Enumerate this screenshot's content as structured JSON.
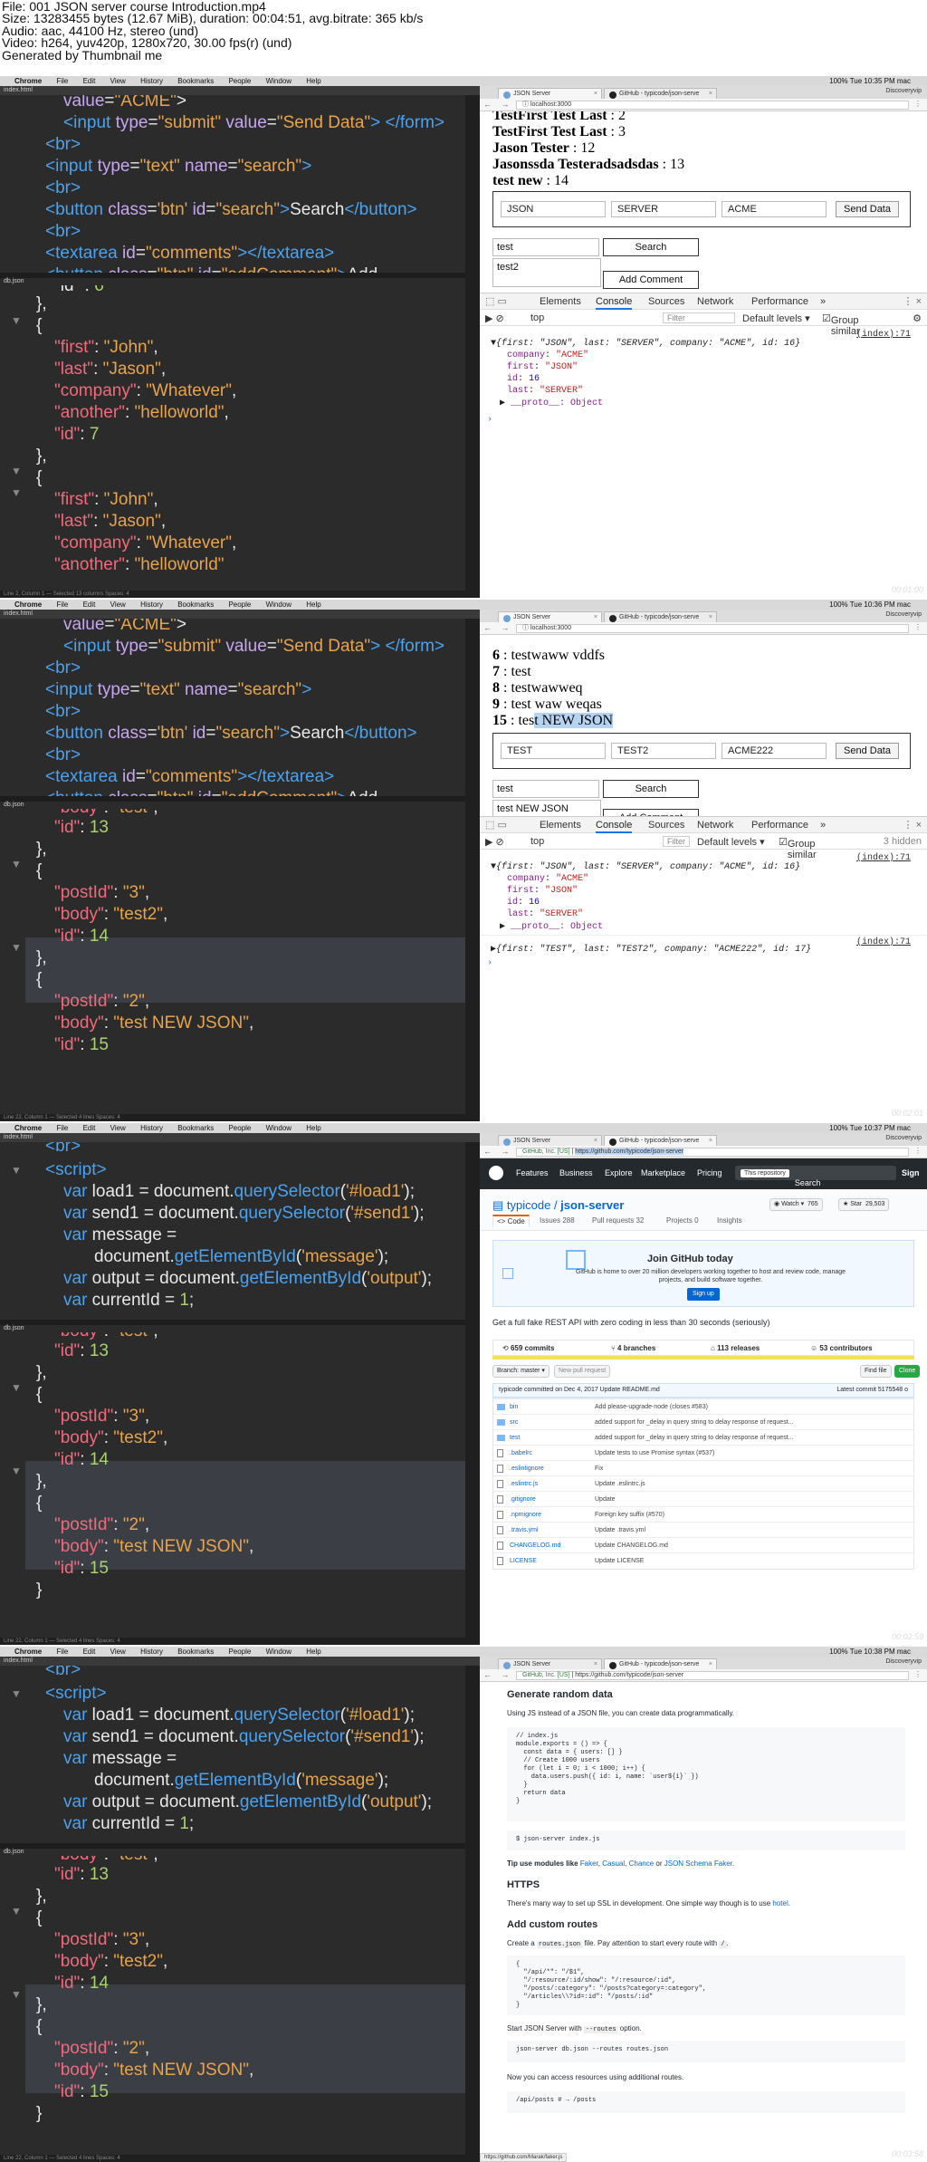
{
  "header": {
    "lines": [
      "File: 001 JSON server course Introduction.mp4",
      "Size: 13283455 bytes (12.67 MiB), duration: 00:04:51, avg.bitrate: 365 kb/s",
      "Audio: aac, 44100 Hz, stereo (und)",
      "Video: h264, yuv420p, 1280x720, 30.00 fps(r) (und)",
      "Generated by Thumbnail me"
    ]
  },
  "menubar": {
    "apple": "",
    "items": [
      "Chrome",
      "File",
      "Edit",
      "View",
      "History",
      "Bookmarks",
      "People",
      "Window",
      "Help"
    ]
  },
  "frames": [
    {
      "status_time": "100% Tue 10:35 PM mac",
      "watermark": "00:01:00",
      "file1": "index.html",
      "file2": "db.json",
      "tabs": [
        {
          "label": "JSON Server"
        },
        {
          "label": "GitHub - typicode/json-serve"
        }
      ],
      "profile": "Discoveryvip",
      "url": "localhost:3000",
      "records": [
        {
          "name": "TestFirst Test Last",
          "id": "2"
        },
        {
          "name": "TestFirst Test Last",
          "id": "3"
        },
        {
          "name": "Jason Tester",
          "id": "12"
        },
        {
          "name": "Jasonssda Testeradsadsdas",
          "id": "13"
        },
        {
          "name": "test new",
          "id": "14"
        }
      ],
      "form": {
        "v1": "JSON",
        "v2": "SERVER",
        "v3": "ACME",
        "btn": "Send Data"
      },
      "search_value": "test",
      "search_btn": "Search",
      "textarea_value": "test2",
      "comment_btn": "Add Comment",
      "statusbar": "Line 2, Column 1 — Selected 13 columns   Spaces: 4"
    },
    {
      "status_time": "100% Tue 10:36 PM mac",
      "watermark": "00:02:01",
      "file1": "index.html",
      "file2": "db.json",
      "tabs": [
        {
          "label": "JSON Server"
        },
        {
          "label": "GitHub - typicode/json-serve"
        }
      ],
      "profile": "Discoveryvip",
      "url": "localhost:3000",
      "records": [
        {
          "id": "6",
          "body": "testwaww vddfs"
        },
        {
          "id": "7",
          "body": "test"
        },
        {
          "id": "8",
          "body": "testwawweq"
        },
        {
          "id": "9",
          "body": "test waw weqas"
        },
        {
          "id": "15",
          "body_pre": "tes",
          "body_sel": "t NEW JSON"
        }
      ],
      "form": {
        "v1": "TEST",
        "v2": "TEST2",
        "v3": "ACME222",
        "btn": "Send Data"
      },
      "search_value": "test",
      "search_btn": "Search",
      "textarea_value": "test NEW JSON",
      "comment_btn": "Add Comment",
      "statusbar": "Line 22, Column 1 — Selected 4 lines   Spaces: 4"
    },
    {
      "status_time": "100% Tue 10:37 PM mac",
      "watermark": "00:02:59",
      "file1": "index.html",
      "file2": "db.json",
      "tabs": [
        {
          "label": "JSON Server"
        },
        {
          "label": "GitHub - typicode/json-serve"
        }
      ],
      "profile": "Discoveryvip",
      "url_prefix": "GitHub, Inc. [US]",
      "url": "https://github.com/typicode/json-server",
      "github": {
        "nav": [
          "Features",
          "Business",
          "Explore",
          "Marketplace",
          "Pricing"
        ],
        "search_scope": "This repository",
        "search_placeholder": "Search",
        "signin": "Sign",
        "owner": "typicode",
        "repo": "json-server",
        "watch": "Watch",
        "watch_count": "765",
        "star": "★ Star",
        "star_count": "29,503",
        "reponav": [
          "<> Code",
          "Issues 288",
          "Pull requests 32",
          "Projects 0",
          "Insights"
        ],
        "banner_title": "Join GitHub today",
        "banner_text": "GitHub is home to over 20 million developers working together to host and review code, manage projects, and build software together.",
        "signup": "Sign up",
        "desc": "Get a full fake REST API with zero coding in less than 30 seconds (seriously)",
        "stats": [
          "659 commits",
          "4 branches",
          "113 releases",
          "53 contributors"
        ],
        "branch": "Branch: master ▾",
        "new_pr": "New pull request",
        "find_file": "Find file",
        "clone": "Clone",
        "commit": "typicode committed on Dec 4, 2017 Update README.md",
        "latest_commit": "Latest commit 5175548 o",
        "files": [
          {
            "name": "bin",
            "msg": "Add please-upgrade-node (closes #583)",
            "type": "dir"
          },
          {
            "name": "src",
            "msg": "added support for _delay in query string to delay response of request...",
            "type": "dir"
          },
          {
            "name": "test",
            "msg": "added support for _delay in query string to delay response of request...",
            "type": "dir"
          },
          {
            "name": ".babelrc",
            "msg": "Update tests to use Promise syntax (#537)",
            "type": "file"
          },
          {
            "name": ".eslintignore",
            "msg": "Fix",
            "type": "file"
          },
          {
            "name": ".eslintrc.js",
            "msg": "Update .eslintrc.js",
            "type": "file"
          },
          {
            "name": ".gitignore",
            "msg": "Update",
            "type": "file"
          },
          {
            "name": ".npmignore",
            "msg": "Foreign key suffix (#570)",
            "type": "file"
          },
          {
            "name": ".travis.yml",
            "msg": "Update .travis.yml",
            "type": "file"
          },
          {
            "name": "CHANGELOG.md",
            "msg": "Update CHANGELOG.md",
            "type": "file"
          },
          {
            "name": "LICENSE",
            "msg": "Update LICENSE",
            "type": "file"
          }
        ]
      },
      "statusbar": "Line 22, Column 1 — Selected 4 lines   Spaces: 4"
    },
    {
      "status_time": "100% Tue 10:38 PM mac",
      "watermark": "00:03:58",
      "file1": "index.html",
      "file2": "db.json",
      "tabs": [
        {
          "label": "JSON Server"
        },
        {
          "label": "GitHub - typicode/json-serve"
        }
      ],
      "profile": "Discoveryvip",
      "url_prefix": "GitHub, Inc. [US]",
      "url": "https://github.com/typicode/json-server",
      "readme": {
        "h1": "Generate random data",
        "p1": "Using JS instead of a JSON file, you can create data programmatically.",
        "code1": "// index.js\nmodule.exports = () => {\n  const data = { users: [] }\n  // Create 1000 users\n  for (let i = 0; i < 1000; i++) {\n    data.users.push({ id: i, name: `user${i}` })\n  }\n  return data\n}",
        "cmd1": "$ json-server index.js",
        "tip_pre": "Tip use modules like ",
        "tip_links": [
          "Faker",
          "Casual",
          "Chance"
        ],
        "tip_or": " or ",
        "tip_last": "JSON Schema Faker",
        "tip_end": ".",
        "h2": "HTTPS",
        "p2_pre": "There's many way to set up SSL in development. One simple way though is to use ",
        "p2_link": "hotel",
        "p2_end": ".",
        "h3": "Add custom routes",
        "p3_pre": "Create a ",
        "p3_code": "routes.json",
        "p3_mid": " file. Pay attention to start every route with ",
        "p3_code2": "/",
        "p3_end": ".",
        "code2": "{\n  \"/api/*\": \"/$1\",\n  \"/:resource/:id/show\": \"/:resource/:id\",\n  \"/posts/:category\": \"/posts?category=:category\",\n  \"/articles\\\\?id=:id\": \"/posts/:id\"\n}",
        "p4_pre": "Start JSON Server with ",
        "p4_code": "--routes",
        "p4_end": " option.",
        "cmd2": "json-server db.json --routes routes.json",
        "p5": "Now you can access resources using additional routes.",
        "cmd3": "/api/posts # → /posts",
        "status_url": "https://github.com/Marak/faker.js"
      },
      "statusbar": "Line 22, Column 1 — Selected 4 lines   Spaces: 4"
    }
  ],
  "devtools": {
    "tabs": [
      "Elements",
      "Console",
      "Sources",
      "Network",
      "Performance",
      "»"
    ],
    "top": "top",
    "filter": "Filter",
    "levels": "Default levels ▾",
    "group": "Group similar",
    "hidden": "3 hidden",
    "src": "(index):71",
    "obj_summary_1": "{first: \"JSON\", last: \"SERVER\", company: \"ACME\", id: 16}",
    "obj_summary_2": "{first: \"TEST\", last: \"TEST2\", company: \"ACME222\", id: 17}",
    "props": [
      {
        "k": "company",
        "v": "\"ACME\"",
        "t": "s"
      },
      {
        "k": "first",
        "v": "\"JSON\"",
        "t": "s"
      },
      {
        "k": "id",
        "v": "16",
        "t": "n"
      },
      {
        "k": "last",
        "v": "\"SERVER\"",
        "t": "s"
      }
    ],
    "proto": "__proto__: Object"
  }
}
